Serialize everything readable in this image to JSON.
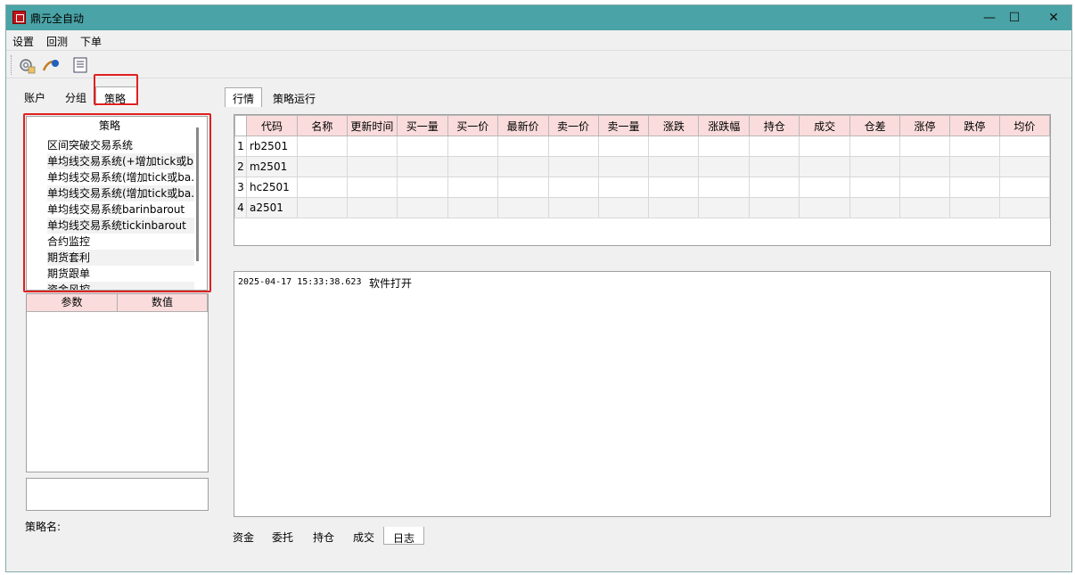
{
  "window": {
    "title": "鼎元全自动",
    "minimize": "—",
    "maximize": "☐",
    "close": "✕"
  },
  "menu": {
    "settings": "设置",
    "backtest": "回测",
    "order": "下单"
  },
  "left_tabs": {
    "account": "账户",
    "group": "分组",
    "strategy": "策略"
  },
  "strategy_list": {
    "header": "策略",
    "items": [
      "区间突破交易系统",
      "单均线交易系统(+增加tick或b...",
      "单均线交易系统(增加tick或ba...",
      "单均线交易系统(增加tick或ba...",
      "单均线交易系统barinbarout",
      "单均线交易系统tickinbarout",
      "合约监控",
      "期货套利",
      "期货跟单",
      "资金风控"
    ]
  },
  "param_table": {
    "col_param": "参数",
    "col_value": "数值"
  },
  "strategy_name_label": "策略名:",
  "right_tabs": {
    "market": "行情",
    "strategy_run": "策略运行"
  },
  "market_table": {
    "columns": [
      "代码",
      "名称",
      "更新时间",
      "买一量",
      "买一价",
      "最新价",
      "卖一价",
      "卖一量",
      "涨跌",
      "涨跌幅",
      "持仓",
      "成交",
      "仓差",
      "涨停",
      "跌停",
      "均价"
    ],
    "rows": [
      {
        "num": "1",
        "code": "rb2501"
      },
      {
        "num": "2",
        "code": "m2501"
      },
      {
        "num": "3",
        "code": "hc2501"
      },
      {
        "num": "4",
        "code": "a2501"
      }
    ]
  },
  "log": {
    "timestamp": "2025-04-17 15:33:38.623",
    "message": "软件打开"
  },
  "bottom_tabs": {
    "funds": "资金",
    "entrust": "委托",
    "position": "持仓",
    "trade": "成交",
    "log": "日志"
  },
  "colors": {
    "titlebar": "#4aa3a6",
    "header_pink": "#fbdcdc",
    "highlight_red": "#e02020"
  }
}
